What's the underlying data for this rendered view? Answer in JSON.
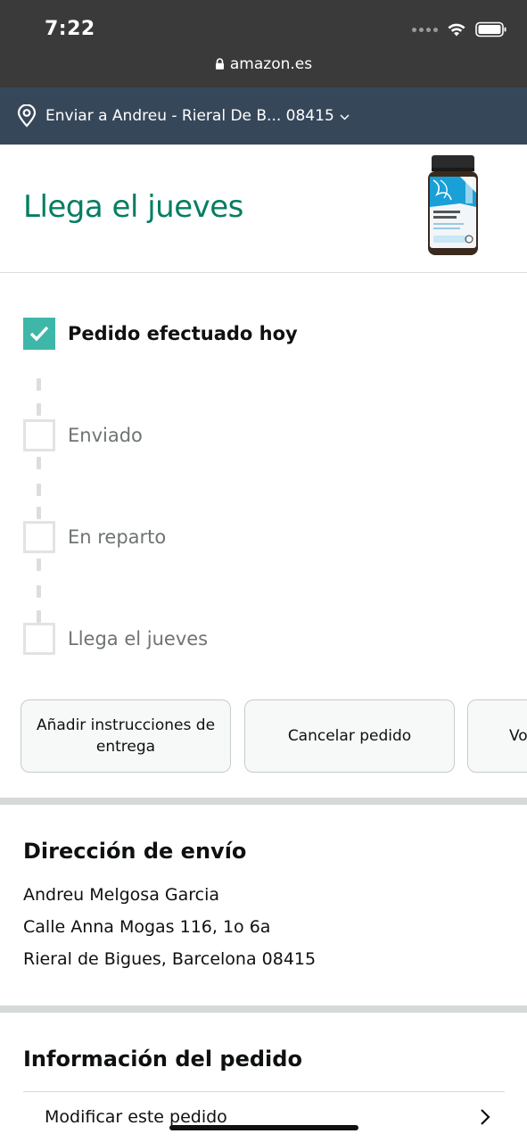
{
  "status_bar": {
    "time": "7:22",
    "url": "amazon.es"
  },
  "delivery": {
    "text": "Enviar a Andreu - Rieral De B... 08415"
  },
  "arrival": {
    "title": "Llega el jueves",
    "product_image_alt": "product-bottle"
  },
  "timeline": {
    "steps": [
      {
        "label": "Pedido efectuado hoy",
        "done": true
      },
      {
        "label": "Enviado",
        "done": false
      },
      {
        "label": "En reparto",
        "done": false
      },
      {
        "label": "Llega el jueves",
        "done": false
      }
    ]
  },
  "actions": {
    "add_instructions": "Añadir instrucciones de entrega",
    "cancel": "Cancelar pedido",
    "third_partial": "Vo"
  },
  "shipping": {
    "title": "Dirección de envío",
    "name": "Andreu Melgosa Garcia",
    "street": "Calle Anna Mogas 116, 1o 6a",
    "city": "Rieral de Bigues, Barcelona 08415"
  },
  "order_info": {
    "title": "Información del pedido",
    "modify": "Modificar este pedido"
  },
  "colors": {
    "accent_green": "#067d62",
    "check_teal": "#3fb7a8",
    "nav_bar": "#37475a"
  }
}
